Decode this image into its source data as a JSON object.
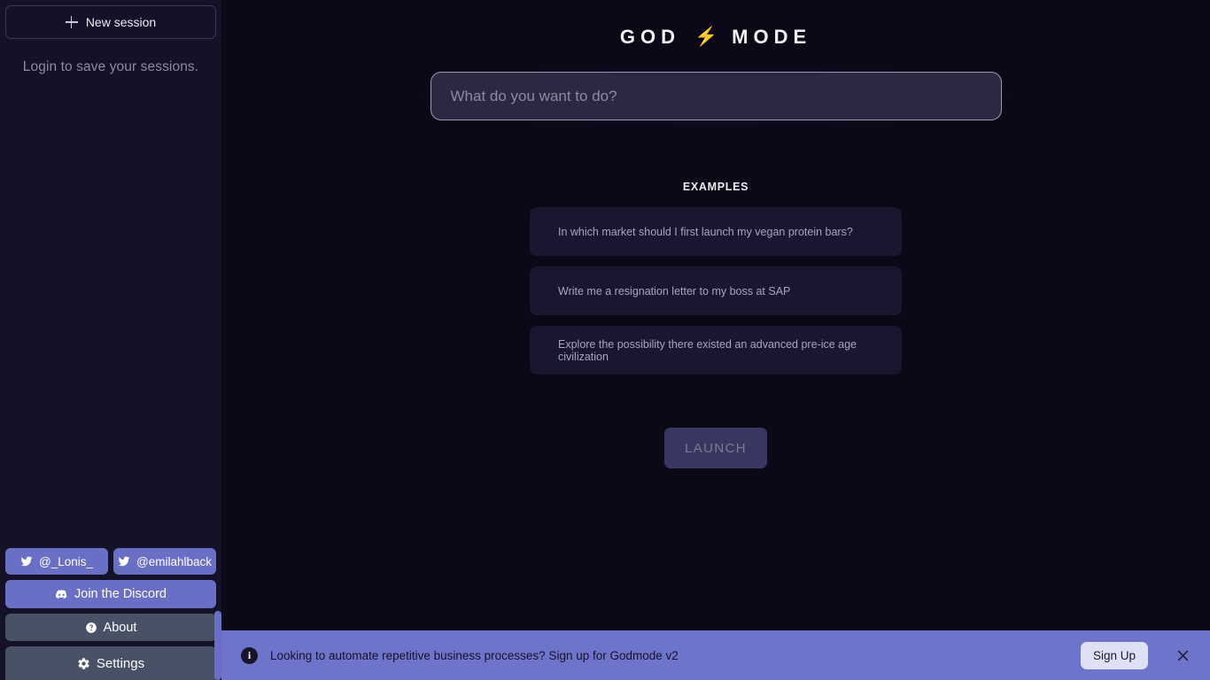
{
  "sidebar": {
    "new_session_label": "New session",
    "login_note": "Login to save your sessions.",
    "twitter": [
      {
        "label": "@_Lonis_"
      },
      {
        "label": "@emilahlback"
      }
    ],
    "discord_label": "Join the Discord",
    "about_label": "About",
    "settings_label": "Settings"
  },
  "header": {
    "brand_left": "GOD",
    "brand_right": "MODE",
    "bolt": "⚡",
    "bolt_color": "#f0902a"
  },
  "prompt": {
    "placeholder": "What do you want to do?",
    "value": ""
  },
  "examples": {
    "title": "EXAMPLES",
    "items": [
      {
        "text": "In which market should I first launch my vegan protein bars?"
      },
      {
        "text": "Write me a resignation letter to my boss at SAP"
      },
      {
        "text": "Explore the possibility there existed an advanced pre-ice age civilization"
      }
    ]
  },
  "launch": {
    "label": "LAUNCH",
    "enabled": false
  },
  "banner": {
    "icon": "info-icon",
    "text": "Looking to automate repetitive business processes? Sign up for Godmode v2",
    "signup_label": "Sign Up",
    "close_label": "×",
    "background": "#6f74cb"
  },
  "theme": {
    "sidebar_bg": "#141129",
    "main_bg": "#0b0818",
    "card_bg": "#191630",
    "purple": "#6a6fc6",
    "slate": "#495167",
    "accent_orange": "#f0902a"
  }
}
